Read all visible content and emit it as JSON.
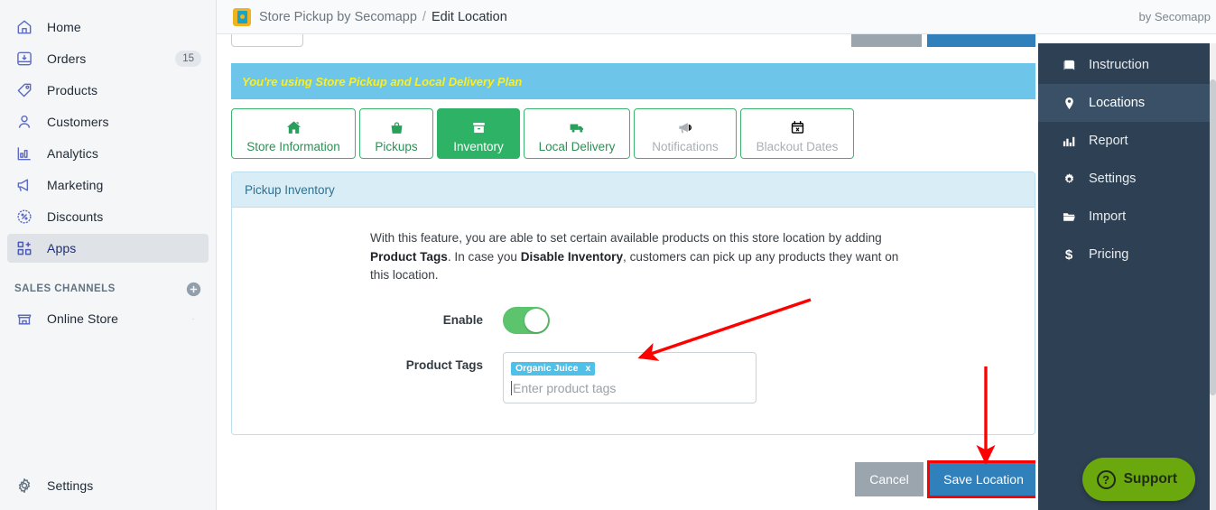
{
  "topbar": {
    "app_icon": "store-pickup-app-icon",
    "breadcrumb_app": "Store Pickup by Secomapp",
    "breadcrumb_sep": "/",
    "breadcrumb_page": "Edit Location",
    "by_line": "by Secomapp"
  },
  "sidebar": {
    "items": [
      {
        "label": "Home",
        "icon": "home-icon",
        "badge": ""
      },
      {
        "label": "Orders",
        "icon": "orders-icon",
        "badge": "15"
      },
      {
        "label": "Products",
        "icon": "products-tag-icon",
        "badge": ""
      },
      {
        "label": "Customers",
        "icon": "customers-icon",
        "badge": ""
      },
      {
        "label": "Analytics",
        "icon": "analytics-icon",
        "badge": ""
      },
      {
        "label": "Marketing",
        "icon": "marketing-megaphone-icon",
        "badge": ""
      },
      {
        "label": "Discounts",
        "icon": "discounts-icon",
        "badge": ""
      },
      {
        "label": "Apps",
        "icon": "apps-grid-icon",
        "badge": ""
      }
    ],
    "sales_channels_header": "SALES CHANNELS",
    "add_icon": "plus-circle-icon",
    "channels": [
      {
        "label": "Online Store",
        "icon": "online-store-icon",
        "trailing_icon": "eye-icon"
      }
    ],
    "settings": {
      "label": "Settings",
      "icon": "gear-icon"
    }
  },
  "app_nav": {
    "items": [
      {
        "label": "Instruction",
        "icon": "book-icon"
      },
      {
        "label": "Locations",
        "icon": "map-pin-icon"
      },
      {
        "label": "Report",
        "icon": "bar-chart-icon"
      },
      {
        "label": "Settings",
        "icon": "gear-icon"
      },
      {
        "label": "Import",
        "icon": "folder-open-icon"
      },
      {
        "label": "Pricing",
        "icon": "dollar-icon"
      }
    ],
    "active": "Locations"
  },
  "banner": {
    "text": "You're using Store Pickup and Local Delivery Plan",
    "bg_color": "#6dc6ea",
    "text_color": "#fbee21"
  },
  "tabs": [
    {
      "label": "Store Information",
      "icon": "house-icon",
      "state": "normal"
    },
    {
      "label": "Pickups",
      "icon": "shopping-bag-icon",
      "state": "normal"
    },
    {
      "label": "Inventory",
      "icon": "box-icon",
      "state": "active"
    },
    {
      "label": "Local Delivery",
      "icon": "delivery-truck-icon",
      "state": "normal"
    },
    {
      "label": "Notifications",
      "icon": "megaphone-icon",
      "state": "disabled"
    },
    {
      "label": "Blackout Dates",
      "icon": "calendar-x-icon",
      "state": "disabled"
    }
  ],
  "panel": {
    "title": "Pickup Inventory",
    "description": {
      "part1": "With this feature, you are able to set certain available products on this store location by adding ",
      "bold1": "Product Tags",
      "part2": ". In case you ",
      "bold2": "Disable Inventory",
      "part3": ", customers can pick up any products they want on this location."
    },
    "enable": {
      "label": "Enable",
      "value": "on"
    },
    "product_tags": {
      "label": "Product Tags",
      "placeholder": "Enter product tags",
      "tags": [
        {
          "text": "Organic Juice",
          "remove": "x"
        }
      ],
      "value": ""
    }
  },
  "footer": {
    "cancel_label": "Cancel",
    "save_label": "Save Location",
    "save_highlight_color": "#ff0000"
  },
  "support": {
    "label": "Support",
    "icon": "question-circle-icon",
    "bg_color": "#6aa80d"
  },
  "annotations": {
    "arrow_color": "#ff0000",
    "arrow_to_tag_input": "diagonal-arrow-pointing-to-product-tags-field",
    "arrow_to_save": "vertical-arrow-pointing-to-save-location-button"
  }
}
